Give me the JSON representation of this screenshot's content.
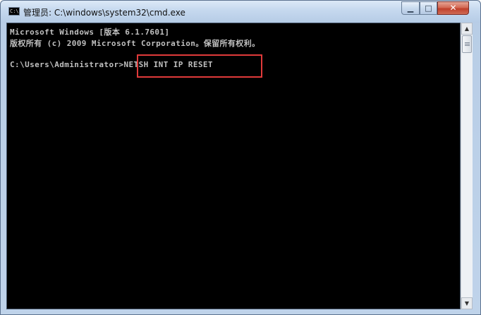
{
  "window": {
    "title": "管理员: C:\\windows\\system32\\cmd.exe",
    "icon_text": "C:\\",
    "controls": {
      "minimize": "▁",
      "maximize": "□",
      "close": "✕"
    }
  },
  "console": {
    "lines": [
      "Microsoft Windows [版本 6.1.7601]",
      "版权所有 (c) 2009 Microsoft Corporation。保留所有权利。",
      "",
      "C:\\Users\\Administrator>NETSH INT IP RESET"
    ]
  },
  "annotation": {
    "color": "#e03a3a"
  },
  "scrollbar": {
    "up_glyph": "▲",
    "down_glyph": "▼"
  }
}
